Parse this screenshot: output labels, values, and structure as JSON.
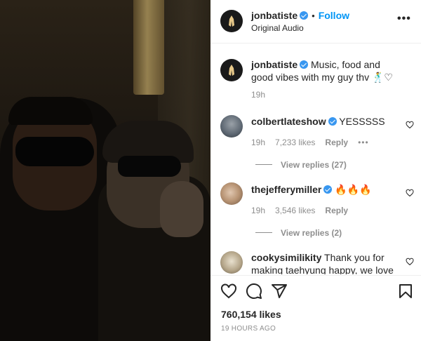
{
  "post": {
    "author": "jonbatiste",
    "follow_label": "Follow",
    "audio_label": "Original Audio",
    "caption": "Music, food and good vibes with my guy thv",
    "caption_emoji": "🕺♡",
    "caption_time": "19h"
  },
  "comments": [
    {
      "username": "colbertlateshow",
      "verified": true,
      "text": "YESSSSS",
      "time": "19h",
      "likes": "7,233 likes",
      "reply_label": "Reply",
      "more": "•••",
      "view_replies": "View replies (27)"
    },
    {
      "username": "thejefferymiller",
      "verified": true,
      "text": "🔥🔥🔥",
      "time": "19h",
      "likes": "3,546 likes",
      "reply_label": "Reply",
      "view_replies": "View replies (2)"
    },
    {
      "username": "cookysimilikity",
      "text": "Thank you for",
      "text_cont": "making taehyung happy, we love u"
    }
  ],
  "footer": {
    "likes": "760,154 likes",
    "time_ago": "19 HOURS AGO"
  },
  "icons": {
    "header_more": "more-icon",
    "like": "heart-icon",
    "comment": "comment-icon",
    "share": "share-icon",
    "save": "bookmark-icon"
  },
  "colors": {
    "accent": "#0095f6",
    "verified": "#3897f0",
    "muted": "#8e8e8e"
  }
}
